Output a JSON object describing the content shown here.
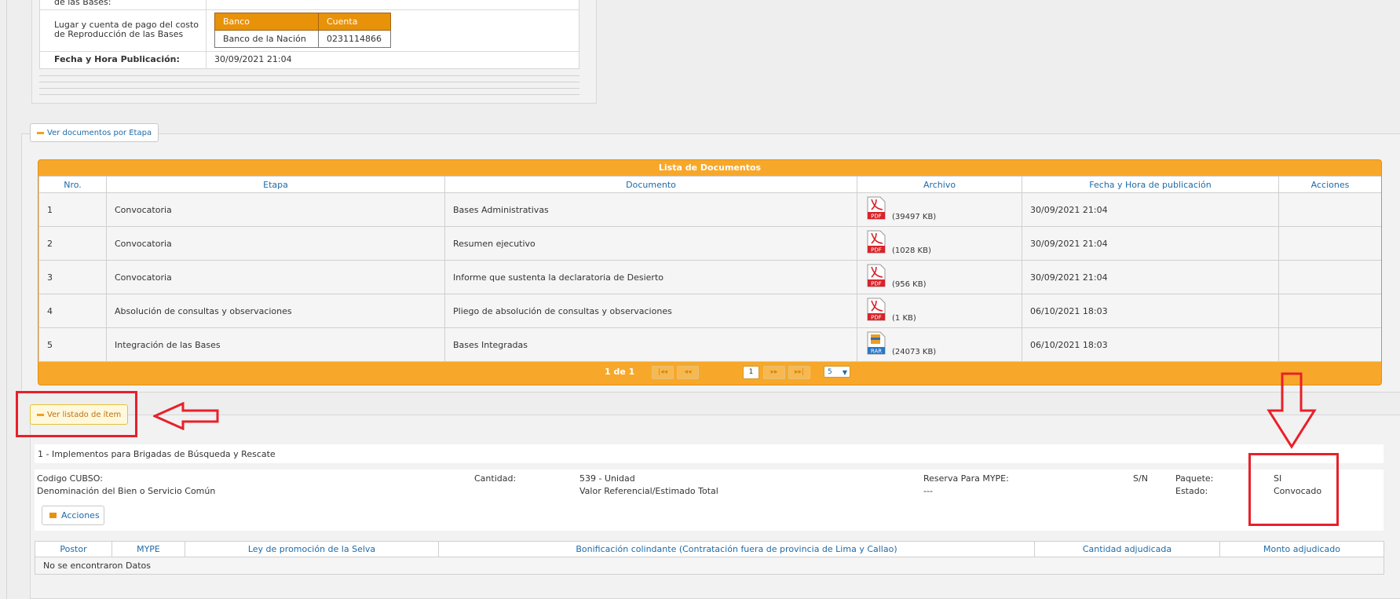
{
  "top_info": {
    "row0_label": "de las Bases:",
    "row1_label": "Lugar y cuenta de pago del costo de Reproducción de las Bases",
    "bank_headers": [
      "Banco",
      "Cuenta"
    ],
    "bank_row": [
      "Banco de la Nación",
      "0231114866"
    ],
    "row2_label": "Fecha y Hora Publicación:",
    "row2_value": "30/09/2021 21:04"
  },
  "docs_section": {
    "toggle_label": "Ver documentos por Etapa",
    "table_title": "Lista de Documentos",
    "columns": [
      "Nro.",
      "Etapa",
      "Documento",
      "Archivo",
      "Fecha y Hora de publicación",
      "Acciones"
    ],
    "rows": [
      {
        "nro": "1",
        "etapa": "Convocatoria",
        "documento": "Bases Administrativas",
        "file_type": "PDF",
        "size": "(39497 KB)",
        "fecha": "30/09/2021 21:04"
      },
      {
        "nro": "2",
        "etapa": "Convocatoria",
        "documento": "Resumen ejecutivo",
        "file_type": "PDF",
        "size": "(1028 KB)",
        "fecha": "30/09/2021 21:04"
      },
      {
        "nro": "3",
        "etapa": "Convocatoria",
        "documento": "Informe que sustenta la declaratoria de Desierto",
        "file_type": "PDF",
        "size": "(956 KB)",
        "fecha": "30/09/2021 21:04"
      },
      {
        "nro": "4",
        "etapa": "Absolución de consultas y observaciones",
        "documento": "Pliego de absolución de consultas y observaciones",
        "file_type": "PDF",
        "size": "(1 KB)",
        "fecha": "06/10/2021 18:03"
      },
      {
        "nro": "5",
        "etapa": "Integración de las Bases",
        "documento": "Bases Integradas",
        "file_type": "RAR",
        "size": "(24073 KB)",
        "fecha": "06/10/2021 18:03"
      }
    ],
    "pager": {
      "info": "1 de 1",
      "first": "|◂◂",
      "prev": "◂◂",
      "current": "1",
      "next": "▸▸",
      "last": "▸▸|",
      "page_size": "5"
    }
  },
  "items_section": {
    "toggle_label": "Ver listado de ítem",
    "item_title": "1 - Implementos para Brigadas de Búsqueda y Rescate",
    "codigo_label": "Codigo CUBSO:",
    "denominacion_label": "Denominación del Bien o Servicio Común",
    "cantidad_label": "Cantidad:",
    "cantidad_value": "539 - Unidad",
    "valor_label": "Valor Referencial/Estimado Total",
    "reserva_label": "Reserva Para MYPE:",
    "reserva_value": "S/N",
    "valor_value": "---",
    "paquete_label": "Paquete:",
    "paquete_value": "SI",
    "estado_label": "Estado:",
    "estado_value": "Convocado",
    "acciones_label": "Acciones",
    "postor_columns": [
      "Postor",
      "MYPE",
      "Ley de promoción de la Selva",
      "Bonificación colindante (Contratación fuera de provincia de Lima y Callao)",
      "Cantidad adjudicada",
      "Monto adjudicado"
    ],
    "empty_text": "No se encontraron Datos"
  },
  "colors": {
    "accent_orange": "#f7a82a",
    "link_blue": "#1d6aa8",
    "annotation_red": "#e8202a"
  }
}
